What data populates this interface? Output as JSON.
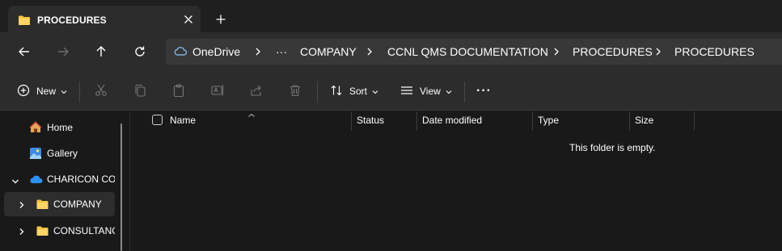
{
  "tab": {
    "title": "PROCEDURES",
    "icons": {
      "folder": "folder-icon",
      "close": "close-icon",
      "new_tab": "plus-icon"
    }
  },
  "navigation": {
    "icons": [
      "back-arrow-icon",
      "forward-arrow-icon",
      "up-arrow-icon",
      "refresh-icon"
    ],
    "breadcrumb": [
      {
        "label": "OneDrive",
        "icon": "cloud-icon"
      },
      {
        "label": "···"
      },
      {
        "label": "COMPANY"
      },
      {
        "label": "CCNL QMS DOCUMENTATION"
      },
      {
        "label": "PROCEDURES"
      },
      {
        "label": "PROCEDURES"
      }
    ]
  },
  "commandbar": {
    "new_label": "New",
    "sort_label": "Sort",
    "view_label": "View",
    "more_label": "···",
    "disabled_icons": [
      "cut-icon",
      "copy-icon",
      "paste-icon",
      "rename-icon",
      "share-icon",
      "delete-icon"
    ]
  },
  "sidebar": {
    "items": [
      {
        "label": "Home",
        "icon": "home-icon"
      },
      {
        "label": "Gallery",
        "icon": "gallery-icon"
      },
      {
        "label": "CHARICON COMPANY",
        "icon": "onedrive-cloud-icon",
        "expanded": true
      },
      {
        "label": "COMPANY",
        "icon": "folder-icon",
        "selected": true
      },
      {
        "label": "CONSULTANCY",
        "icon": "folder-icon"
      }
    ]
  },
  "columns": [
    "Name",
    "Status",
    "Date modified",
    "Type",
    "Size"
  ],
  "empty_message": "This folder is empty.",
  "colors": {
    "titlebar": "#1f1f1f",
    "toolbar": "#2c2c2c",
    "address": "#383838",
    "background": "#191919",
    "folder": "#f6c343",
    "onedrive": "#4aa3ff"
  }
}
